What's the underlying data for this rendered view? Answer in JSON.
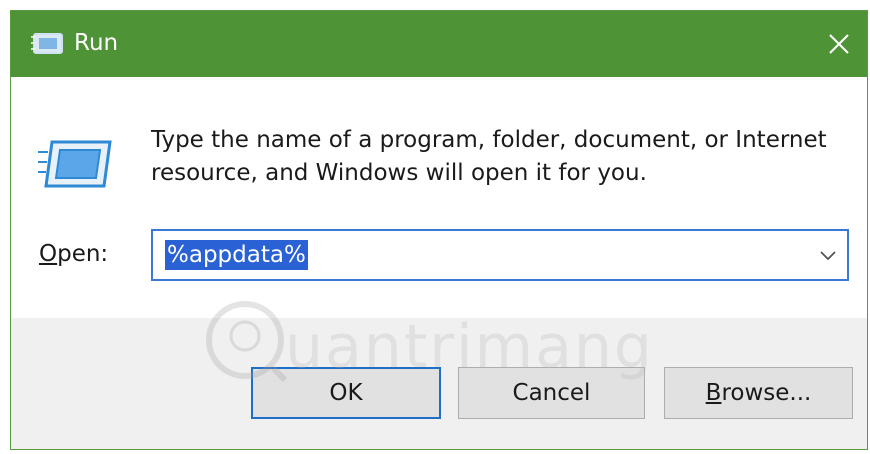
{
  "window": {
    "title": "Run",
    "icons": {
      "title": "run-dialog-icon",
      "close": "close-icon",
      "body": "run-program-icon",
      "dropdown": "chevron-down-icon"
    },
    "accent_color": "#4f9337"
  },
  "description": {
    "line1": "Type the name of a program, folder, document, or Internet",
    "line2": "resource, and Windows will open it for you."
  },
  "open_field": {
    "label_mnemonic": "O",
    "label_rest": "pen:",
    "value": "%appdata%",
    "selection_color": "#2a62d5"
  },
  "buttons": {
    "ok": "OK",
    "cancel": "Cancel",
    "browse_mnemonic": "B",
    "browse_rest": "rowse..."
  },
  "watermark": {
    "text": "uantrimang"
  }
}
